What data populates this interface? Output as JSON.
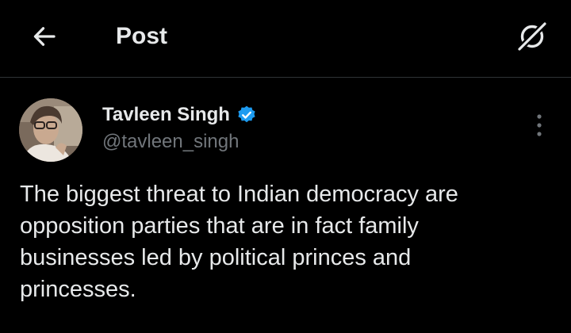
{
  "header": {
    "title": "Post",
    "back_icon": "arrow-left-icon",
    "grok_icon": "grok-icon"
  },
  "tweet": {
    "author": {
      "display_name": "Tavleen Singh",
      "handle": "@tavleen_singh",
      "verified": true,
      "verified_color": "#1d9bf0"
    },
    "text": "The biggest threat to Indian democracy are\nopposition parties that are in fact family\nbusinesses led by political princes and\nprincesses."
  },
  "theme": {
    "background": "#000000",
    "text": "#e7e9ea",
    "secondary_text": "#71767b",
    "divider": "#2f3336"
  }
}
